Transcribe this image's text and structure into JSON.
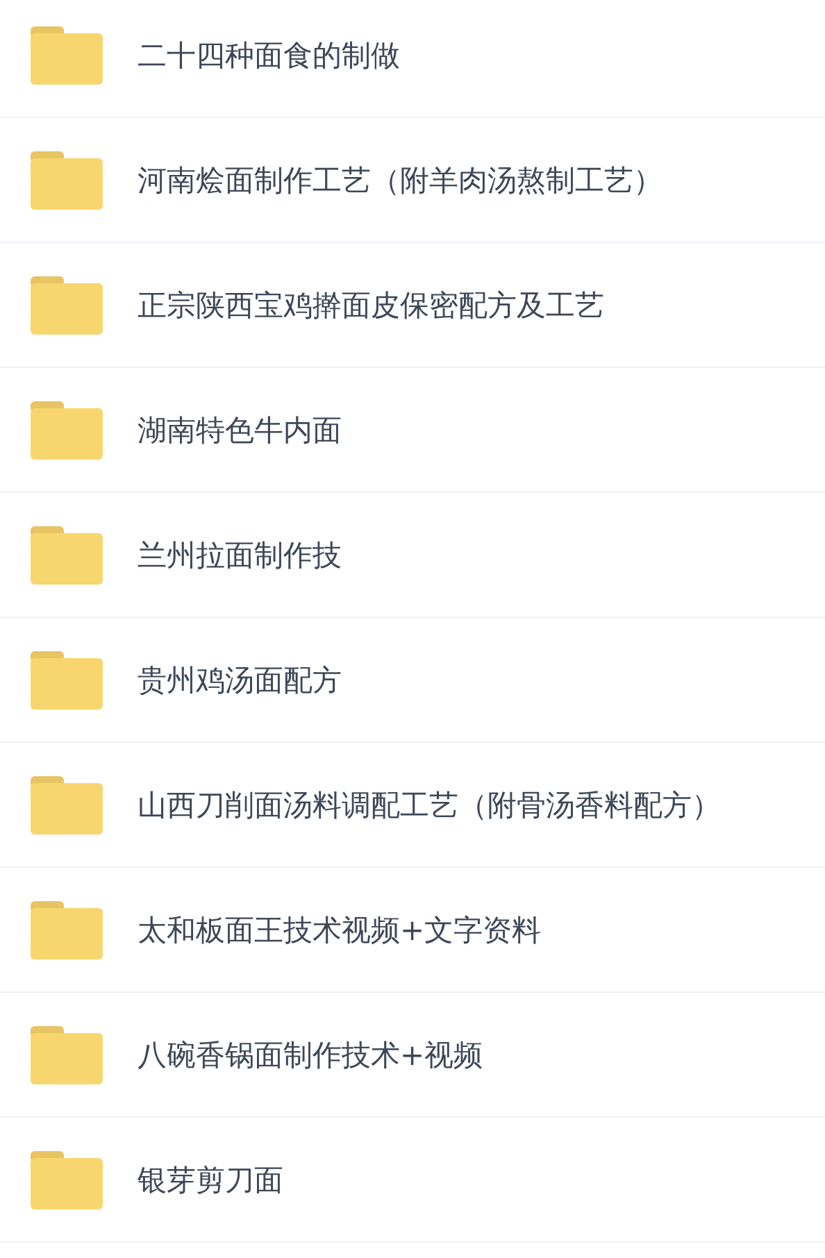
{
  "folders": [
    {
      "name": "二十四种面食的制做"
    },
    {
      "name": "河南烩面制作工艺（附羊肉汤熬制工艺）"
    },
    {
      "name": "正宗陕西宝鸡擀面皮保密配方及工艺"
    },
    {
      "name": "湖南特色牛内面"
    },
    {
      "name": "兰州拉面制作技"
    },
    {
      "name": "贵州鸡汤面配方"
    },
    {
      "name": "山西刀削面汤料调配工艺（附骨汤香料配方）"
    },
    {
      "name": "太和板面王技术视频+文字资料"
    },
    {
      "name": "八碗香锅面制作技术+视频"
    },
    {
      "name": "银芽剪刀面"
    }
  ]
}
